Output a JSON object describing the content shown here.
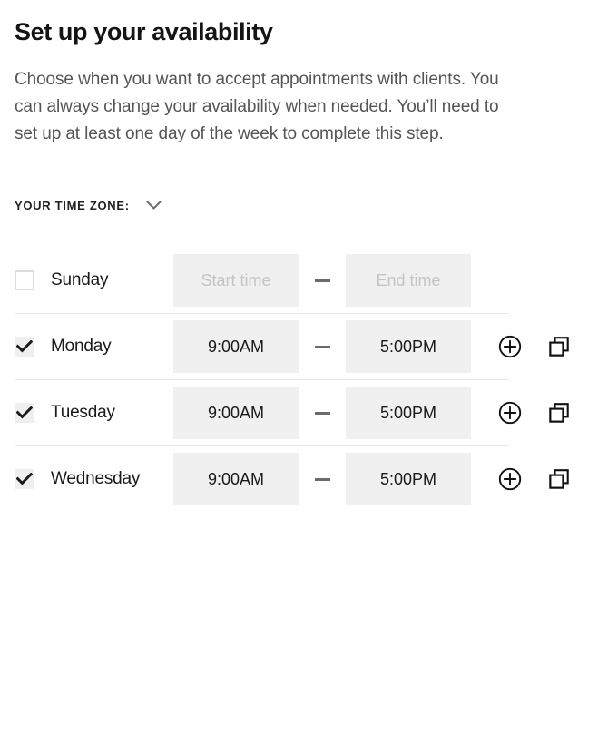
{
  "header": {
    "title": "Set up your availability",
    "description": "Choose when you want to accept appointments with clients. You can always change your availability when needed. You’ll need to set up at least one day of the week to complete this step."
  },
  "timezone": {
    "label": "YOUR TIME ZONE:",
    "chevron_icon": "chevron-down-icon"
  },
  "separator": "—",
  "placeholders": {
    "start_time": "Start time",
    "end_time": "End time"
  },
  "icons": {
    "add": "plus-circle-icon",
    "duplicate": "copy-icon",
    "checkmark": "check-icon"
  },
  "colors": {
    "field_background": "#f0f0f0",
    "divider": "#e8e8e8",
    "checkbox_border": "#dcdcdc",
    "checkbox_checked_bg": "#efefef",
    "placeholder_text": "#c4c4c4",
    "body_text": "#555555",
    "title_text": "#141414"
  },
  "days": [
    {
      "name": "Sunday",
      "checked": false,
      "start_time": "",
      "end_time": "",
      "has_actions": false
    },
    {
      "name": "Monday",
      "checked": true,
      "start_time": "9:00AM",
      "end_time": "5:00PM",
      "has_actions": true
    },
    {
      "name": "Tuesday",
      "checked": true,
      "start_time": "9:00AM",
      "end_time": "5:00PM",
      "has_actions": true
    },
    {
      "name": "Wednesday",
      "checked": true,
      "start_time": "9:00AM",
      "end_time": "5:00PM",
      "has_actions": true
    }
  ]
}
